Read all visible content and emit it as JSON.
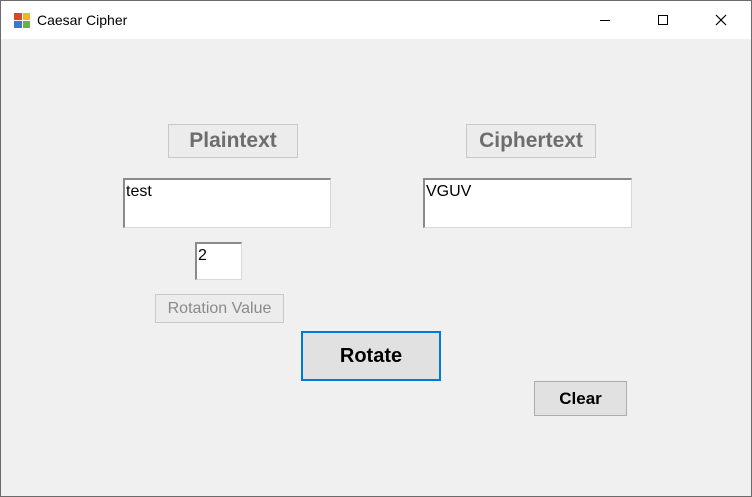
{
  "window": {
    "title": "Caesar Cipher",
    "app_icon": "winforms-app-icon",
    "controls": [
      "minimize-icon",
      "maximize-icon",
      "close-icon"
    ]
  },
  "form": {
    "plaintext_label": "Plaintext",
    "ciphertext_label": "Ciphertext",
    "plaintext_value": "test",
    "ciphertext_value": "VGUV",
    "rotation_value": "2",
    "rotation_label": "Rotation Value",
    "rotate_button": "Rotate",
    "clear_button": "Clear"
  },
  "colors": {
    "background": "#f0f0f0",
    "titlebar": "#ffffff",
    "focus_border": "#0078d7",
    "button_face": "#e1e1e1",
    "disabled_text": "#6d6d6d"
  }
}
